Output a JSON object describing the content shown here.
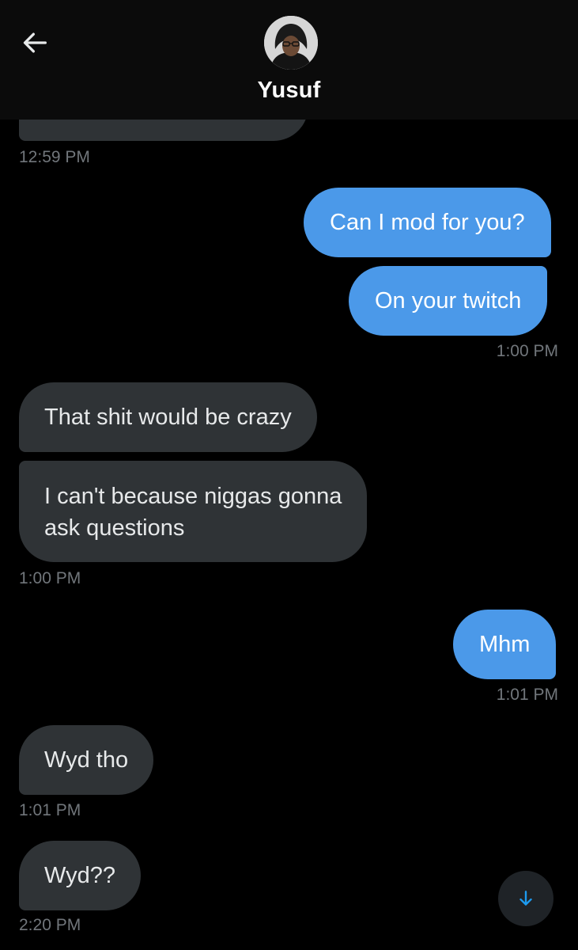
{
  "header": {
    "contact_name": "Yusuf"
  },
  "icons": {
    "back": "arrow-left-icon",
    "avatar": "avatar",
    "scroll_down": "arrow-down-icon"
  },
  "colors": {
    "background": "#000000",
    "incoming_bubble": "#2f3336",
    "outgoing_bubble": "#4b99e9",
    "timestamp": "#71767b",
    "accent": "#1d9bf0"
  },
  "messages": [
    {
      "direction": "in",
      "text": "",
      "partial": true
    },
    {
      "direction": "time",
      "text": "12:59 PM"
    },
    {
      "direction": "out",
      "text": "Can I mod for you?"
    },
    {
      "direction": "out",
      "text": "On your twitch"
    },
    {
      "direction": "time",
      "text": "1:00 PM"
    },
    {
      "direction": "in",
      "text": "That shit would be crazy"
    },
    {
      "direction": "in",
      "text": "I can't because niggas gonna ask questions"
    },
    {
      "direction": "time",
      "text": "1:00 PM"
    },
    {
      "direction": "out",
      "text": "Mhm"
    },
    {
      "direction": "time",
      "text": "1:01 PM"
    },
    {
      "direction": "in",
      "text": "Wyd tho"
    },
    {
      "direction": "time",
      "text": "1:01 PM"
    },
    {
      "direction": "in",
      "text": "Wyd??"
    },
    {
      "direction": "time",
      "text": "2:20 PM"
    }
  ],
  "bubble_lines": {
    "msg6_line1": "I can't because niggas gonna",
    "msg6_line2": "ask questions"
  }
}
